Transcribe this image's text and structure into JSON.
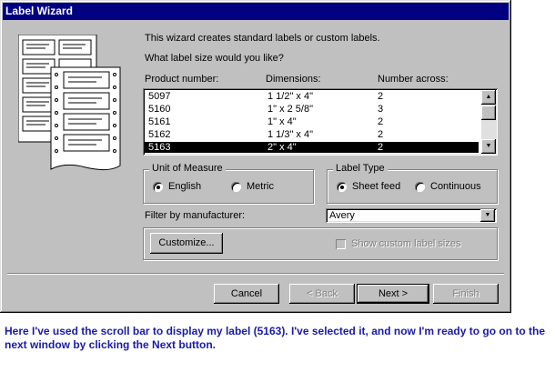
{
  "window": {
    "title": "Label Wizard"
  },
  "intro": {
    "line1": "This wizard creates standard labels or custom labels.",
    "line2": "What label size would you like?"
  },
  "table": {
    "headers": {
      "product": "Product number:",
      "dimensions": "Dimensions:",
      "across": "Number across:"
    },
    "rows": [
      {
        "product": "5097",
        "dimensions": "1 1/2\" x 4\"",
        "across": "2"
      },
      {
        "product": "5160",
        "dimensions": "1\" x 2 5/8\"",
        "across": "3"
      },
      {
        "product": "5161",
        "dimensions": "1\" x 4\"",
        "across": "2"
      },
      {
        "product": "5162",
        "dimensions": "1 1/3\" x 4\"",
        "across": "2"
      },
      {
        "product": "5163",
        "dimensions": "2\" x 4\"",
        "across": "2"
      }
    ],
    "selected_product": "5163"
  },
  "unit_of_measure": {
    "label": "Unit of Measure",
    "options": [
      {
        "label": "English",
        "selected": true
      },
      {
        "label": "Metric",
        "selected": false
      }
    ]
  },
  "label_type": {
    "label": "Label Type",
    "options": [
      {
        "label": "Sheet feed",
        "selected": true
      },
      {
        "label": "Continuous",
        "selected": false
      }
    ]
  },
  "filter": {
    "label": "Filter by  manufacturer:",
    "value": "Avery"
  },
  "customize": {
    "button_label": "Customize...",
    "show_custom_label": "Show custom label sizes",
    "show_custom_checked": false
  },
  "footer": {
    "cancel": "Cancel",
    "back": "< Back",
    "next": "Next >",
    "finish": "Finish"
  },
  "caption": "Here I've used the scroll bar to display my label (5163). I've selected it, and now I'm ready to go on to the next window by clicking the Next button."
}
